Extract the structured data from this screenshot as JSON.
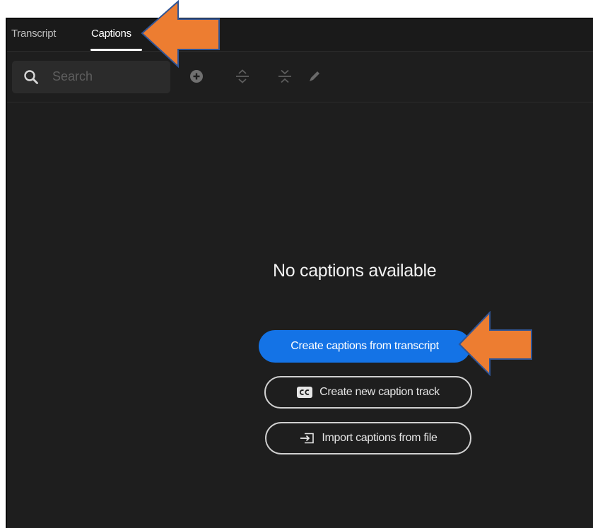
{
  "tabs": {
    "transcript_label": "Transcript",
    "captions_label": "Captions"
  },
  "toolbar": {
    "search_placeholder": "Search",
    "icons": [
      "search-icon",
      "add-icon",
      "expand-icon",
      "collapse-icon",
      "edit-icon"
    ]
  },
  "empty_state": {
    "message": "No captions available",
    "create_from_transcript_label": "Create captions from transcript",
    "create_new_track_label": "Create new caption track",
    "import_from_file_label": "Import captions from file"
  },
  "colors": {
    "panel_background": "#1e1e1e",
    "primary_button": "#1473e6",
    "annotation_arrow": "#ed7d31",
    "annotation_arrow_outline": "#2f5597"
  }
}
